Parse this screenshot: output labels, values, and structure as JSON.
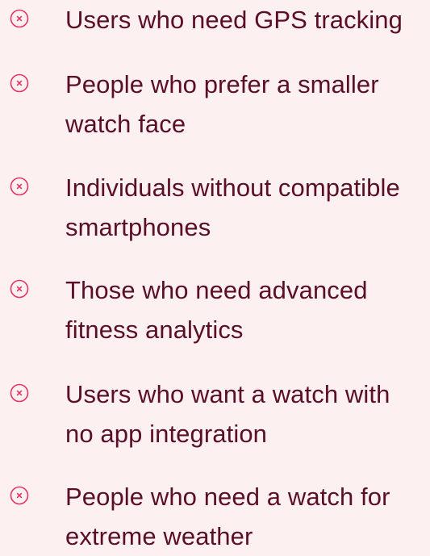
{
  "items": [
    {
      "label": "Users who need GPS tracking",
      "icon": "close-circle-icon"
    },
    {
      "label": "People who prefer a smaller watch face",
      "icon": "close-circle-icon"
    },
    {
      "label": "Individuals without compatible smartphones",
      "icon": "close-circle-icon"
    },
    {
      "label": "Those who need advanced fitness analytics",
      "icon": "close-circle-icon"
    },
    {
      "label": "Users who want a watch with no app integration",
      "icon": "close-circle-icon"
    },
    {
      "label": "People who need a watch for extreme weather",
      "icon": "close-circle-icon"
    }
  ],
  "colors": {
    "background": "#fdf0f1",
    "text": "#5b0f26",
    "icon": "#e5345f"
  }
}
